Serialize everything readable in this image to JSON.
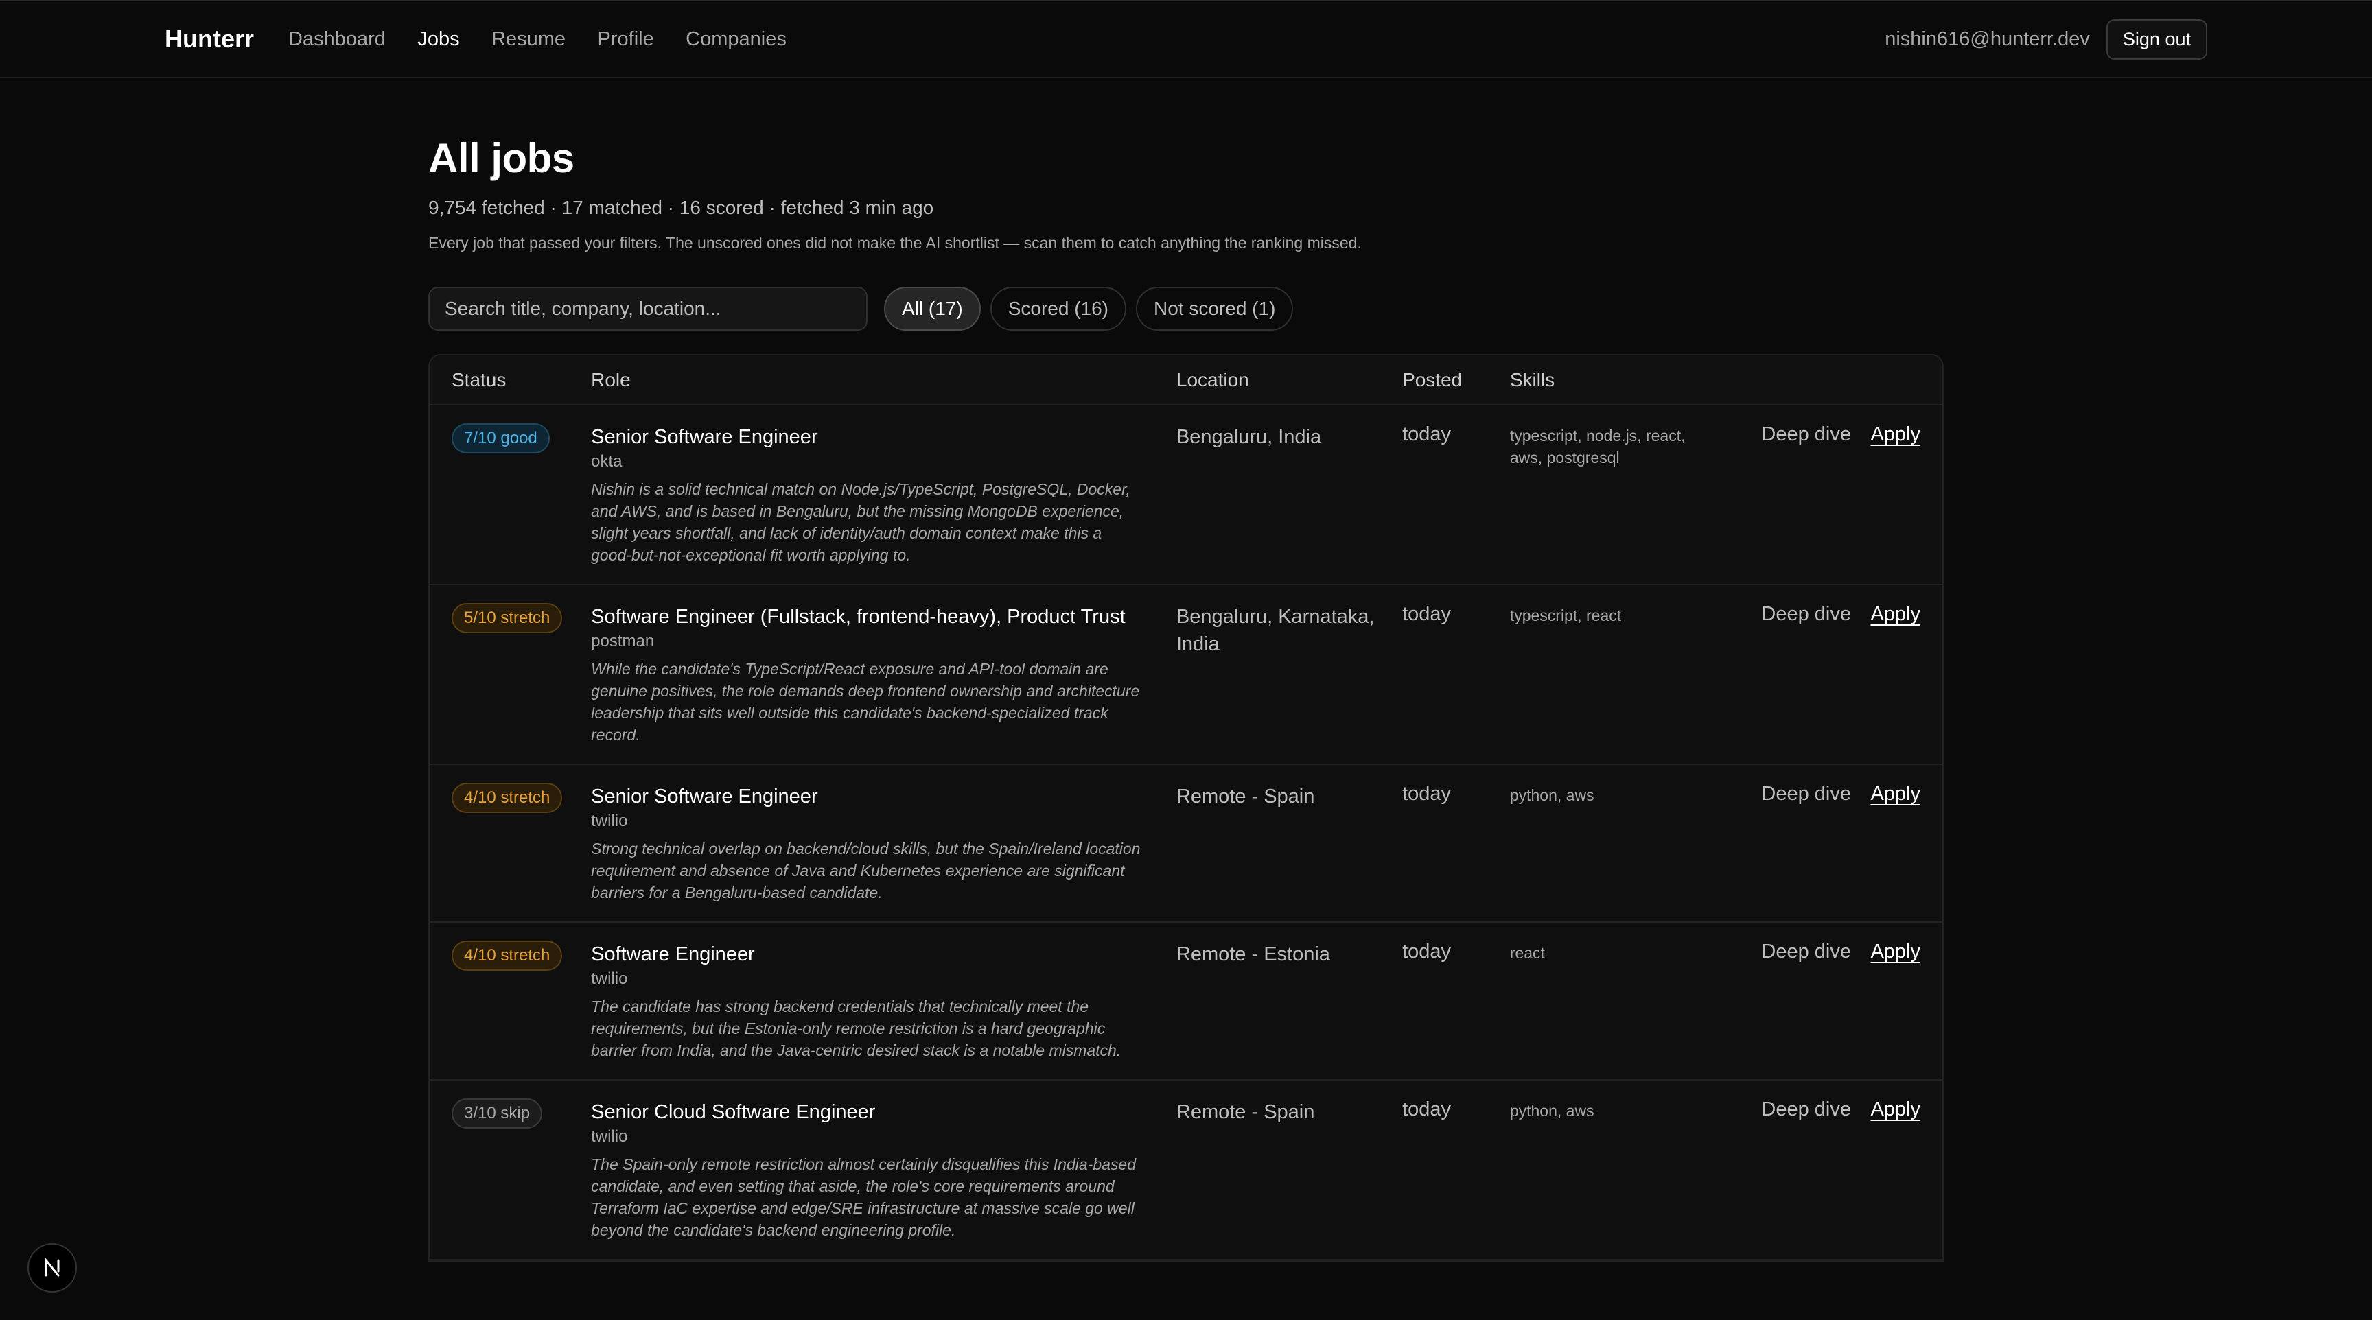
{
  "nav": {
    "brand": "Hunterr",
    "items": [
      "Dashboard",
      "Jobs",
      "Resume",
      "Profile",
      "Companies"
    ],
    "active": 1,
    "user_email": "nishin616@hunterr.dev",
    "signout_label": "Sign out"
  },
  "page": {
    "title": "All jobs",
    "stats": "9,754 fetched · 17 matched · 16 scored · fetched 3 min ago",
    "description": "Every job that passed your filters. The unscored ones did not make the AI shortlist — scan them to catch anything the ranking missed."
  },
  "search": {
    "placeholder": "Search title, company, location..."
  },
  "filters": [
    {
      "label": "All (17)",
      "active": true
    },
    {
      "label": "Scored (16)",
      "active": false
    },
    {
      "label": "Not scored (1)",
      "active": false
    }
  ],
  "table": {
    "headers": [
      "Status",
      "Role",
      "Location",
      "Posted",
      "Skills",
      ""
    ],
    "deep_dive_label": "Deep dive",
    "apply_label": "Apply",
    "rows": [
      {
        "badge": "7/10 good",
        "badge_kind": "good",
        "title": "Senior Software Engineer",
        "company": "okta",
        "reason": "Nishin is a solid technical match on Node.js/TypeScript, PostgreSQL, Docker, and AWS, and is based in Bengaluru, but the missing MongoDB experience, slight years shortfall, and lack of identity/auth domain context make this a good-but-not-exceptional fit worth applying to.",
        "location": "Bengaluru, India",
        "posted": "today",
        "skills": "typescript, node.js, react, aws, postgresql"
      },
      {
        "badge": "5/10 stretch",
        "badge_kind": "stretch",
        "title": "Software Engineer (Fullstack, frontend-heavy), Product Trust",
        "company": "postman",
        "reason": "While the candidate's TypeScript/React exposure and API-tool domain are genuine positives, the role demands deep frontend ownership and architecture leadership that sits well outside this candidate's backend-specialized track record.",
        "location": "Bengaluru, Karnataka, India",
        "posted": "today",
        "skills": "typescript, react"
      },
      {
        "badge": "4/10 stretch",
        "badge_kind": "stretch",
        "title": "Senior Software Engineer",
        "company": "twilio",
        "reason": "Strong technical overlap on backend/cloud skills, but the Spain/Ireland location requirement and absence of Java and Kubernetes experience are significant barriers for a Bengaluru-based candidate.",
        "location": "Remote - Spain",
        "posted": "today",
        "skills": "python, aws"
      },
      {
        "badge": "4/10 stretch",
        "badge_kind": "stretch",
        "title": "Software Engineer",
        "company": "twilio",
        "reason": "The candidate has strong backend credentials that technically meet the requirements, but the Estonia-only remote restriction is a hard geographic barrier from India, and the Java-centric desired stack is a notable mismatch.",
        "location": "Remote - Estonia",
        "posted": "today",
        "skills": "react"
      },
      {
        "badge": "3/10 skip",
        "badge_kind": "skip",
        "title": "Senior Cloud Software Engineer",
        "company": "twilio",
        "reason": "The Spain-only remote restriction almost certainly disqualifies this India-based candidate, and even setting that aside, the role's core requirements around Terraform IaC expertise and edge/SRE infrastructure at massive scale go well beyond the candidate's backend engineering profile.",
        "location": "Remote - Spain",
        "posted": "today",
        "skills": "python, aws"
      }
    ]
  },
  "colors": {
    "good": "#4ab3e8",
    "stretch": "#e8a23a",
    "skip": "#a8a8a8",
    "background": "#0a0a0a"
  },
  "floating": {
    "icon": "nextjs-logo-icon",
    "glyph": "N"
  }
}
